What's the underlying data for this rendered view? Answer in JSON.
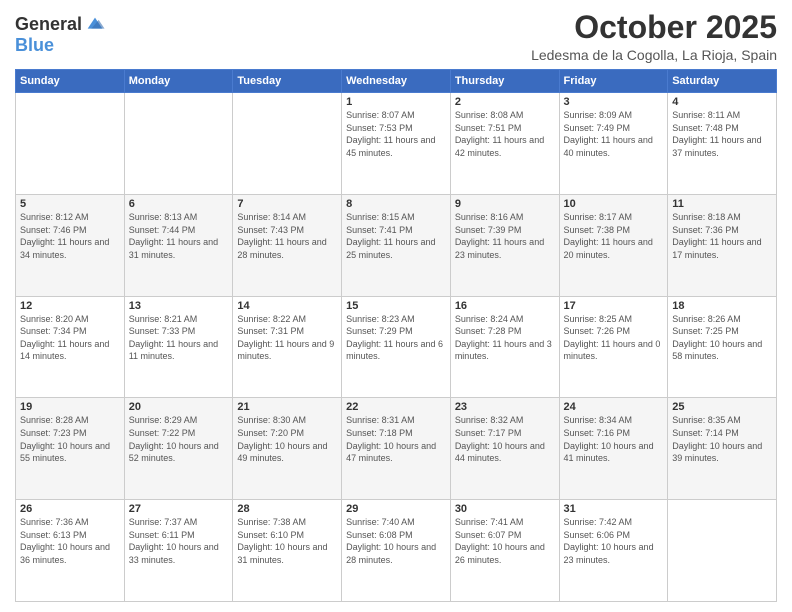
{
  "header": {
    "logo_line1": "General",
    "logo_line2": "Blue",
    "month_title": "October 2025",
    "location": "Ledesma de la Cogolla, La Rioja, Spain"
  },
  "days_of_week": [
    "Sunday",
    "Monday",
    "Tuesday",
    "Wednesday",
    "Thursday",
    "Friday",
    "Saturday"
  ],
  "weeks": [
    [
      {
        "num": "",
        "info": ""
      },
      {
        "num": "",
        "info": ""
      },
      {
        "num": "",
        "info": ""
      },
      {
        "num": "1",
        "info": "Sunrise: 8:07 AM\nSunset: 7:53 PM\nDaylight: 11 hours and 45 minutes."
      },
      {
        "num": "2",
        "info": "Sunrise: 8:08 AM\nSunset: 7:51 PM\nDaylight: 11 hours and 42 minutes."
      },
      {
        "num": "3",
        "info": "Sunrise: 8:09 AM\nSunset: 7:49 PM\nDaylight: 11 hours and 40 minutes."
      },
      {
        "num": "4",
        "info": "Sunrise: 8:11 AM\nSunset: 7:48 PM\nDaylight: 11 hours and 37 minutes."
      }
    ],
    [
      {
        "num": "5",
        "info": "Sunrise: 8:12 AM\nSunset: 7:46 PM\nDaylight: 11 hours and 34 minutes."
      },
      {
        "num": "6",
        "info": "Sunrise: 8:13 AM\nSunset: 7:44 PM\nDaylight: 11 hours and 31 minutes."
      },
      {
        "num": "7",
        "info": "Sunrise: 8:14 AM\nSunset: 7:43 PM\nDaylight: 11 hours and 28 minutes."
      },
      {
        "num": "8",
        "info": "Sunrise: 8:15 AM\nSunset: 7:41 PM\nDaylight: 11 hours and 25 minutes."
      },
      {
        "num": "9",
        "info": "Sunrise: 8:16 AM\nSunset: 7:39 PM\nDaylight: 11 hours and 23 minutes."
      },
      {
        "num": "10",
        "info": "Sunrise: 8:17 AM\nSunset: 7:38 PM\nDaylight: 11 hours and 20 minutes."
      },
      {
        "num": "11",
        "info": "Sunrise: 8:18 AM\nSunset: 7:36 PM\nDaylight: 11 hours and 17 minutes."
      }
    ],
    [
      {
        "num": "12",
        "info": "Sunrise: 8:20 AM\nSunset: 7:34 PM\nDaylight: 11 hours and 14 minutes."
      },
      {
        "num": "13",
        "info": "Sunrise: 8:21 AM\nSunset: 7:33 PM\nDaylight: 11 hours and 11 minutes."
      },
      {
        "num": "14",
        "info": "Sunrise: 8:22 AM\nSunset: 7:31 PM\nDaylight: 11 hours and 9 minutes."
      },
      {
        "num": "15",
        "info": "Sunrise: 8:23 AM\nSunset: 7:29 PM\nDaylight: 11 hours and 6 minutes."
      },
      {
        "num": "16",
        "info": "Sunrise: 8:24 AM\nSunset: 7:28 PM\nDaylight: 11 hours and 3 minutes."
      },
      {
        "num": "17",
        "info": "Sunrise: 8:25 AM\nSunset: 7:26 PM\nDaylight: 11 hours and 0 minutes."
      },
      {
        "num": "18",
        "info": "Sunrise: 8:26 AM\nSunset: 7:25 PM\nDaylight: 10 hours and 58 minutes."
      }
    ],
    [
      {
        "num": "19",
        "info": "Sunrise: 8:28 AM\nSunset: 7:23 PM\nDaylight: 10 hours and 55 minutes."
      },
      {
        "num": "20",
        "info": "Sunrise: 8:29 AM\nSunset: 7:22 PM\nDaylight: 10 hours and 52 minutes."
      },
      {
        "num": "21",
        "info": "Sunrise: 8:30 AM\nSunset: 7:20 PM\nDaylight: 10 hours and 49 minutes."
      },
      {
        "num": "22",
        "info": "Sunrise: 8:31 AM\nSunset: 7:18 PM\nDaylight: 10 hours and 47 minutes."
      },
      {
        "num": "23",
        "info": "Sunrise: 8:32 AM\nSunset: 7:17 PM\nDaylight: 10 hours and 44 minutes."
      },
      {
        "num": "24",
        "info": "Sunrise: 8:34 AM\nSunset: 7:16 PM\nDaylight: 10 hours and 41 minutes."
      },
      {
        "num": "25",
        "info": "Sunrise: 8:35 AM\nSunset: 7:14 PM\nDaylight: 10 hours and 39 minutes."
      }
    ],
    [
      {
        "num": "26",
        "info": "Sunrise: 7:36 AM\nSunset: 6:13 PM\nDaylight: 10 hours and 36 minutes."
      },
      {
        "num": "27",
        "info": "Sunrise: 7:37 AM\nSunset: 6:11 PM\nDaylight: 10 hours and 33 minutes."
      },
      {
        "num": "28",
        "info": "Sunrise: 7:38 AM\nSunset: 6:10 PM\nDaylight: 10 hours and 31 minutes."
      },
      {
        "num": "29",
        "info": "Sunrise: 7:40 AM\nSunset: 6:08 PM\nDaylight: 10 hours and 28 minutes."
      },
      {
        "num": "30",
        "info": "Sunrise: 7:41 AM\nSunset: 6:07 PM\nDaylight: 10 hours and 26 minutes."
      },
      {
        "num": "31",
        "info": "Sunrise: 7:42 AM\nSunset: 6:06 PM\nDaylight: 10 hours and 23 minutes."
      },
      {
        "num": "",
        "info": ""
      }
    ]
  ]
}
